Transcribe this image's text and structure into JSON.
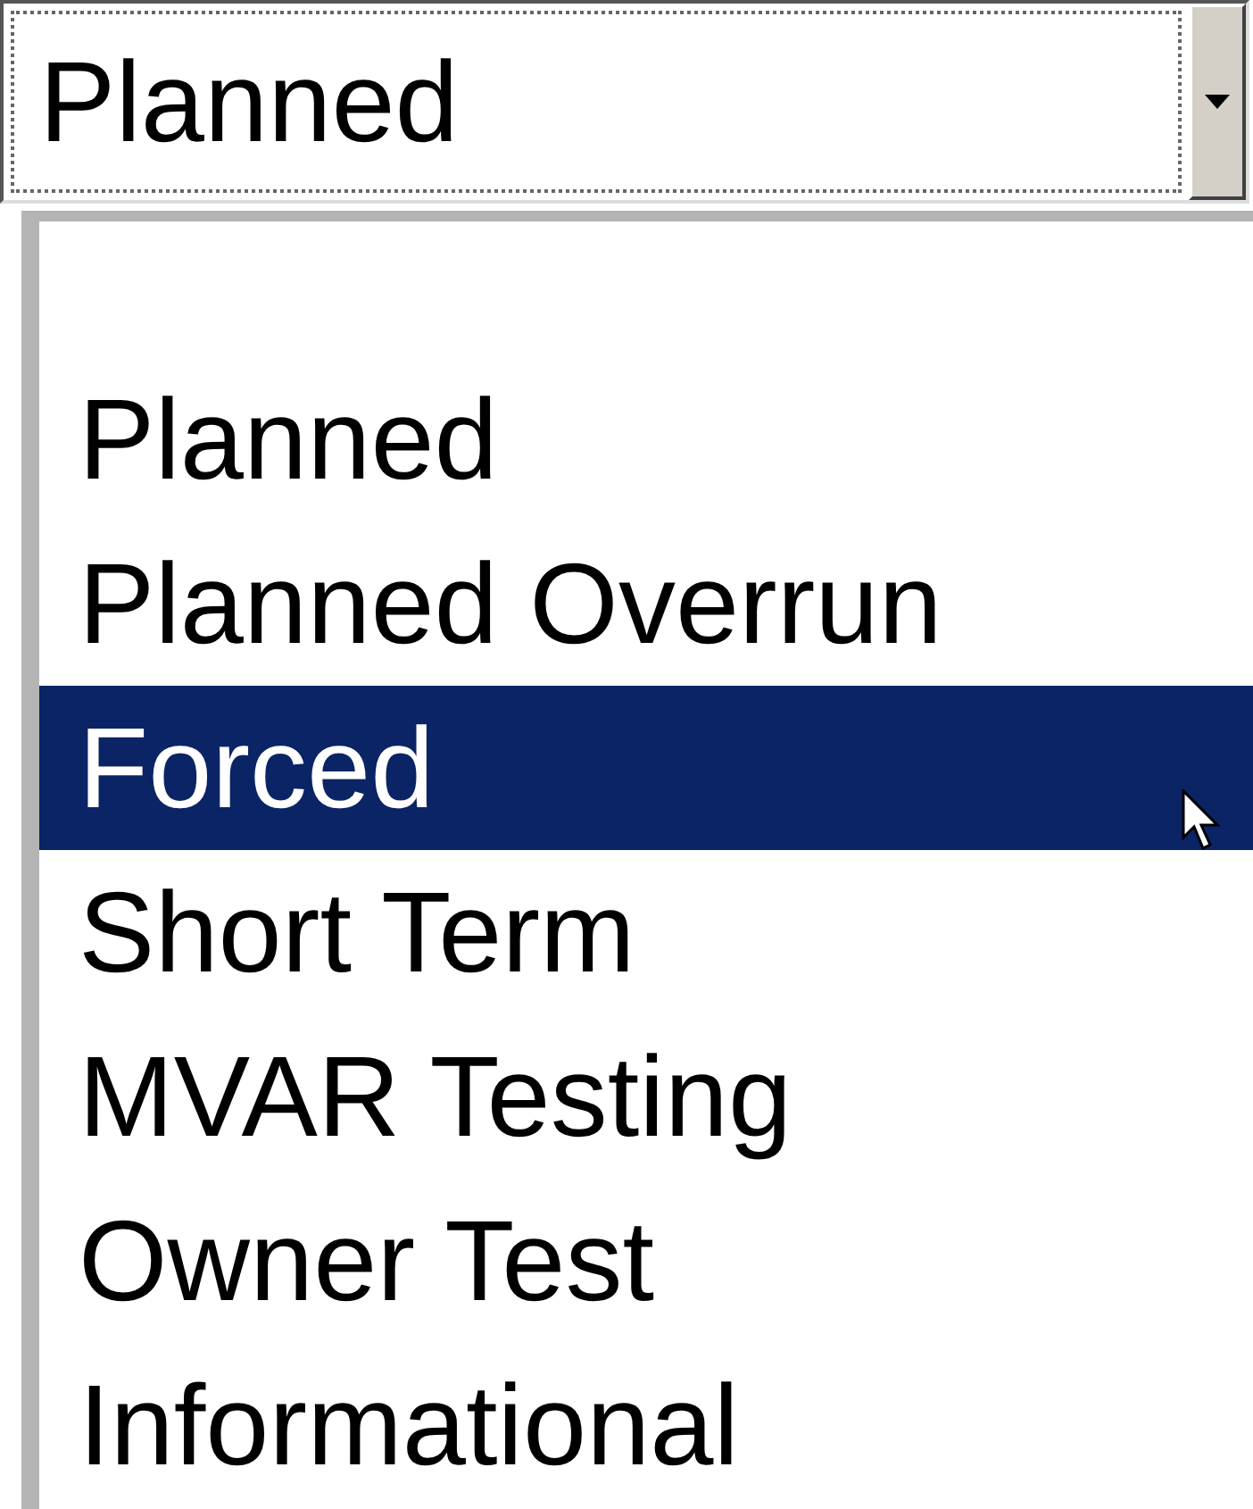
{
  "combo": {
    "value": "Planned"
  },
  "options": [
    {
      "label": "Planned",
      "selected": false
    },
    {
      "label": "Planned Overrun",
      "selected": false
    },
    {
      "label": "Forced",
      "selected": true
    },
    {
      "label": "Short Term",
      "selected": false
    },
    {
      "label": "MVAR Testing",
      "selected": false
    },
    {
      "label": "Owner Test",
      "selected": false
    },
    {
      "label": "Informational",
      "selected": false
    }
  ]
}
